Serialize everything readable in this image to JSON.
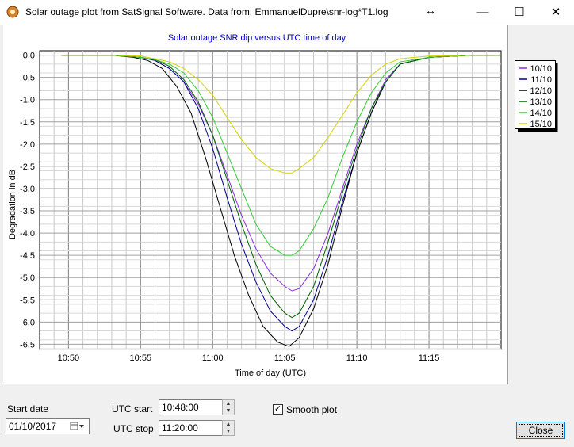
{
  "window": {
    "title": "Solar outage plot from SatSignal Software.  Data from: EmmanuelDupre\\snr-log*T1.log",
    "resize_glyph": "↔",
    "minimize_glyph": "—",
    "maximize_glyph": "☐",
    "close_glyph": "✕"
  },
  "controls": {
    "start_date_label": "Start date",
    "start_date_value": "01/10/2017",
    "utc_start_label": "UTC start",
    "utc_start_value": "10:48:00",
    "utc_stop_label": "UTC stop",
    "utc_stop_value": "11:20:00",
    "smooth_label": "Smooth plot",
    "smooth_checked": true,
    "close_label": "Close"
  },
  "chart_data": {
    "type": "line",
    "title": "Solar outage SNR dip versus UTC time of day",
    "xlabel": "Time of day (UTC)",
    "ylabel": "Degradation in dB",
    "x_unit": "minutes after 10:48 UTC",
    "xlim_time": [
      "10:48",
      "11:20"
    ],
    "xticks": [
      "10:50",
      "10:55",
      "11:00",
      "11:05",
      "11:10",
      "11:15"
    ],
    "ylim": [
      -6.6,
      0.1
    ],
    "yticks": [
      "0.0",
      "-0.5",
      "-1.0",
      "-1.5",
      "-2.0",
      "-2.5",
      "-3.0",
      "-3.5",
      "-4.0",
      "-4.5",
      "-5.0",
      "-5.5",
      "-6.0",
      "-6.5"
    ],
    "grid": true,
    "legend_position": "outside-right",
    "series": [
      {
        "name": "10/10",
        "color": "#8a2be2",
        "points": [
          [
            1.5,
            0.0
          ],
          [
            5,
            0.0
          ],
          [
            7,
            -0.05
          ],
          [
            8,
            -0.12
          ],
          [
            9,
            -0.3
          ],
          [
            10,
            -0.6
          ],
          [
            11,
            -1.1
          ],
          [
            12,
            -1.8
          ],
          [
            13,
            -2.7
          ],
          [
            14,
            -3.6
          ],
          [
            15,
            -4.35
          ],
          [
            16,
            -4.9
          ],
          [
            17,
            -5.2
          ],
          [
            17.5,
            -5.3
          ],
          [
            18,
            -5.25
          ],
          [
            19,
            -4.8
          ],
          [
            20,
            -4.0
          ],
          [
            21,
            -3.0
          ],
          [
            22,
            -2.0
          ],
          [
            23,
            -1.2
          ],
          [
            24,
            -0.55
          ],
          [
            25,
            -0.2
          ],
          [
            27,
            -0.05
          ],
          [
            30,
            0.0
          ],
          [
            32,
            0.0
          ]
        ]
      },
      {
        "name": "11/10",
        "color": "#00008b",
        "points": [
          [
            1.5,
            0.0
          ],
          [
            5,
            0.0
          ],
          [
            7,
            -0.05
          ],
          [
            8,
            -0.12
          ],
          [
            9,
            -0.3
          ],
          [
            10,
            -0.6
          ],
          [
            11,
            -1.2
          ],
          [
            12,
            -2.1
          ],
          [
            13,
            -3.2
          ],
          [
            14,
            -4.25
          ],
          [
            15,
            -5.1
          ],
          [
            16,
            -5.75
          ],
          [
            17,
            -6.1
          ],
          [
            17.5,
            -6.2
          ],
          [
            18,
            -6.1
          ],
          [
            19,
            -5.5
          ],
          [
            20,
            -4.5
          ],
          [
            21,
            -3.3
          ],
          [
            22,
            -2.2
          ],
          [
            23,
            -1.3
          ],
          [
            24,
            -0.6
          ],
          [
            25,
            -0.2
          ],
          [
            27,
            -0.05
          ],
          [
            30,
            0.0
          ],
          [
            32,
            0.0
          ]
        ]
      },
      {
        "name": "12/10",
        "color": "#000000",
        "points": [
          [
            1.5,
            0.0
          ],
          [
            5,
            0.0
          ],
          [
            6.5,
            -0.05
          ],
          [
            7.5,
            -0.12
          ],
          [
            8.5,
            -0.3
          ],
          [
            9.5,
            -0.7
          ],
          [
            10.5,
            -1.3
          ],
          [
            11.5,
            -2.3
          ],
          [
            12.5,
            -3.4
          ],
          [
            13.5,
            -4.5
          ],
          [
            14.5,
            -5.4
          ],
          [
            15.5,
            -6.1
          ],
          [
            16.5,
            -6.45
          ],
          [
            17.3,
            -6.55
          ],
          [
            18,
            -6.35
          ],
          [
            19,
            -5.7
          ],
          [
            20,
            -4.7
          ],
          [
            21,
            -3.4
          ],
          [
            22,
            -2.2
          ],
          [
            23,
            -1.3
          ],
          [
            24,
            -0.6
          ],
          [
            25,
            -0.2
          ],
          [
            27,
            -0.05
          ],
          [
            30,
            0.0
          ],
          [
            32,
            0.0
          ]
        ]
      },
      {
        "name": "13/10",
        "color": "#006400",
        "points": [
          [
            1.5,
            0.0
          ],
          [
            5,
            0.0
          ],
          [
            7,
            -0.05
          ],
          [
            8,
            -0.1
          ],
          [
            9,
            -0.25
          ],
          [
            10,
            -0.55
          ],
          [
            11,
            -1.05
          ],
          [
            12,
            -1.8
          ],
          [
            13,
            -2.8
          ],
          [
            14,
            -3.8
          ],
          [
            15,
            -4.7
          ],
          [
            16,
            -5.4
          ],
          [
            17,
            -5.8
          ],
          [
            17.5,
            -5.9
          ],
          [
            18,
            -5.8
          ],
          [
            19,
            -5.2
          ],
          [
            20,
            -4.2
          ],
          [
            21,
            -3.1
          ],
          [
            22,
            -2.1
          ],
          [
            23,
            -1.2
          ],
          [
            24,
            -0.6
          ],
          [
            25,
            -0.2
          ],
          [
            27,
            -0.05
          ],
          [
            30,
            0.0
          ],
          [
            32,
            0.0
          ]
        ]
      },
      {
        "name": "14/10",
        "color": "#32cd32",
        "points": [
          [
            1.5,
            0.0
          ],
          [
            5,
            0.0
          ],
          [
            7,
            -0.05
          ],
          [
            8,
            -0.1
          ],
          [
            9,
            -0.2
          ],
          [
            10,
            -0.4
          ],
          [
            11,
            -0.8
          ],
          [
            12,
            -1.4
          ],
          [
            13,
            -2.2
          ],
          [
            14,
            -3.0
          ],
          [
            15,
            -3.8
          ],
          [
            16,
            -4.3
          ],
          [
            17,
            -4.5
          ],
          [
            17.5,
            -4.5
          ],
          [
            18,
            -4.4
          ],
          [
            19,
            -3.9
          ],
          [
            20,
            -3.2
          ],
          [
            21,
            -2.3
          ],
          [
            22,
            -1.5
          ],
          [
            23,
            -0.85
          ],
          [
            24,
            -0.4
          ],
          [
            25,
            -0.15
          ],
          [
            27,
            -0.05
          ],
          [
            30,
            0.0
          ],
          [
            32,
            0.0
          ]
        ]
      },
      {
        "name": "15/10",
        "color": "#d4d400",
        "points": [
          [
            1.5,
            0.0
          ],
          [
            5,
            0.0
          ],
          [
            7,
            -0.02
          ],
          [
            8,
            -0.08
          ],
          [
            9,
            -0.15
          ],
          [
            10,
            -0.3
          ],
          [
            11,
            -0.55
          ],
          [
            12,
            -0.9
          ],
          [
            13,
            -1.4
          ],
          [
            14,
            -1.9
          ],
          [
            15,
            -2.3
          ],
          [
            16,
            -2.55
          ],
          [
            17,
            -2.65
          ],
          [
            17.5,
            -2.65
          ],
          [
            18,
            -2.55
          ],
          [
            19,
            -2.3
          ],
          [
            20,
            -1.85
          ],
          [
            21,
            -1.35
          ],
          [
            22,
            -0.85
          ],
          [
            23,
            -0.45
          ],
          [
            24,
            -0.2
          ],
          [
            25,
            -0.08
          ],
          [
            27,
            -0.02
          ],
          [
            30,
            0.0
          ],
          [
            32,
            0.0
          ]
        ]
      }
    ]
  }
}
